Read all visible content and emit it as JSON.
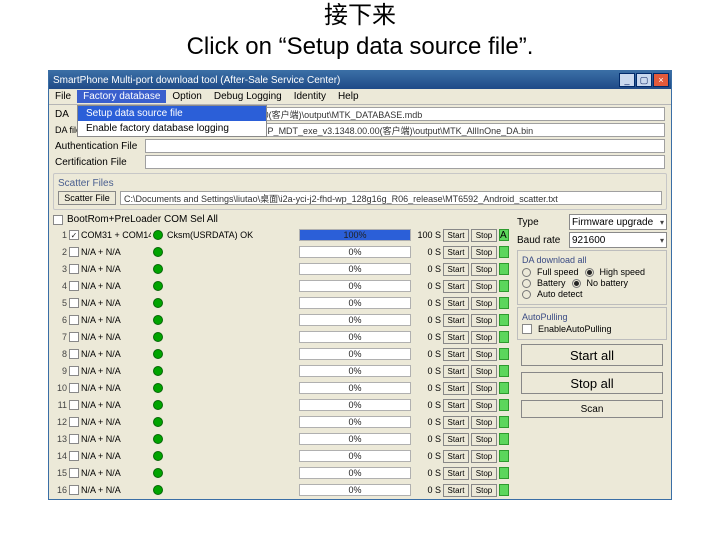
{
  "caption": {
    "cn": "接下来",
    "en": "Click on “Setup data source file”."
  },
  "title": "SmartPhone Multi-port download tool (After-Sale Service Center)",
  "winbtns": {
    "min": "_",
    "max": "▢",
    "close": "×"
  },
  "menu": {
    "items": [
      "File",
      "Factory database",
      "Option",
      "Debug Logging",
      "Identity",
      "Help"
    ],
    "open": 1,
    "dropdown": [
      {
        "label": "Setup data source file",
        "hl": true
      },
      {
        "label": "Enable factory database logging",
        "hl": false
      }
    ]
  },
  "paths": {
    "da_label": "DA",
    "da_row2_label": "DA file name:",
    "da_path": "\\智能1348\\下载\\SP_MDT_exe_v3.1348.00.00(客户端)\\output\\MTK_DATABASE.mdb",
    "da2_path": "F:\\users\\1348下载\\智能1348\\下载\\SP_MDT_exe_v3.1348.00.00(客户端)\\output\\MTK_AllInOne_DA.bin",
    "auth_label": "Authentication File",
    "auth_path": "",
    "cert_label": "Certification File",
    "cert_path": "",
    "scatter_title": "Scatter Files",
    "scatter_btn": "Scatter File",
    "scatter_path": "C:\\Documents and Settings\\liutao\\桌面\\i2a-yci-j2-fhd-wp_128g16g_R06_release\\MT6592_Android_scatter.txt"
  },
  "table": {
    "header": "BootRom+PreLoader COM Sel All",
    "start_label": "Start",
    "stop_label": "Stop",
    "rows": [
      {
        "n": 1,
        "chk": true,
        "com": "COM31 + COM14",
        "status": "Cksm(USRDATA) OK",
        "pct": 100,
        "ts": "100 S",
        "ind": "A"
      },
      {
        "n": 2,
        "chk": false,
        "com": "N/A + N/A",
        "status": "",
        "pct": 0,
        "ts": "0 S",
        "ind": ""
      },
      {
        "n": 3,
        "chk": false,
        "com": "N/A + N/A",
        "status": "",
        "pct": 0,
        "ts": "0 S",
        "ind": ""
      },
      {
        "n": 4,
        "chk": false,
        "com": "N/A + N/A",
        "status": "",
        "pct": 0,
        "ts": "0 S",
        "ind": ""
      },
      {
        "n": 5,
        "chk": false,
        "com": "N/A + N/A",
        "status": "",
        "pct": 0,
        "ts": "0 S",
        "ind": ""
      },
      {
        "n": 6,
        "chk": false,
        "com": "N/A + N/A",
        "status": "",
        "pct": 0,
        "ts": "0 S",
        "ind": ""
      },
      {
        "n": 7,
        "chk": false,
        "com": "N/A + N/A",
        "status": "",
        "pct": 0,
        "ts": "0 S",
        "ind": ""
      },
      {
        "n": 8,
        "chk": false,
        "com": "N/A + N/A",
        "status": "",
        "pct": 0,
        "ts": "0 S",
        "ind": ""
      },
      {
        "n": 9,
        "chk": false,
        "com": "N/A + N/A",
        "status": "",
        "pct": 0,
        "ts": "0 S",
        "ind": ""
      },
      {
        "n": 10,
        "chk": false,
        "com": "N/A + N/A",
        "status": "",
        "pct": 0,
        "ts": "0 S",
        "ind": ""
      },
      {
        "n": 11,
        "chk": false,
        "com": "N/A + N/A",
        "status": "",
        "pct": 0,
        "ts": "0 S",
        "ind": ""
      },
      {
        "n": 12,
        "chk": false,
        "com": "N/A + N/A",
        "status": "",
        "pct": 0,
        "ts": "0 S",
        "ind": ""
      },
      {
        "n": 13,
        "chk": false,
        "com": "N/A + N/A",
        "status": "",
        "pct": 0,
        "ts": "0 S",
        "ind": ""
      },
      {
        "n": 14,
        "chk": false,
        "com": "N/A + N/A",
        "status": "",
        "pct": 0,
        "ts": "0 S",
        "ind": ""
      },
      {
        "n": 15,
        "chk": false,
        "com": "N/A + N/A",
        "status": "",
        "pct": 0,
        "ts": "0 S",
        "ind": ""
      },
      {
        "n": 16,
        "chk": false,
        "com": "N/A + N/A",
        "status": "",
        "pct": 0,
        "ts": "0 S",
        "ind": ""
      }
    ]
  },
  "right": {
    "type_label": "Type",
    "type_value": "Firmware upgrade",
    "baud_label": "Baud rate",
    "baud_value": "921600",
    "da_dl_title": "DA download all",
    "full_speed": "Full speed",
    "high_speed": "High speed",
    "battery": "Battery",
    "no_battery": "No battery",
    "auto_detect": "Auto detect",
    "autop_title": "AutoPulling",
    "autop_enable": "EnableAutoPulling",
    "start_all": "Start all",
    "stop_all": "Stop all",
    "scan": "Scan"
  }
}
